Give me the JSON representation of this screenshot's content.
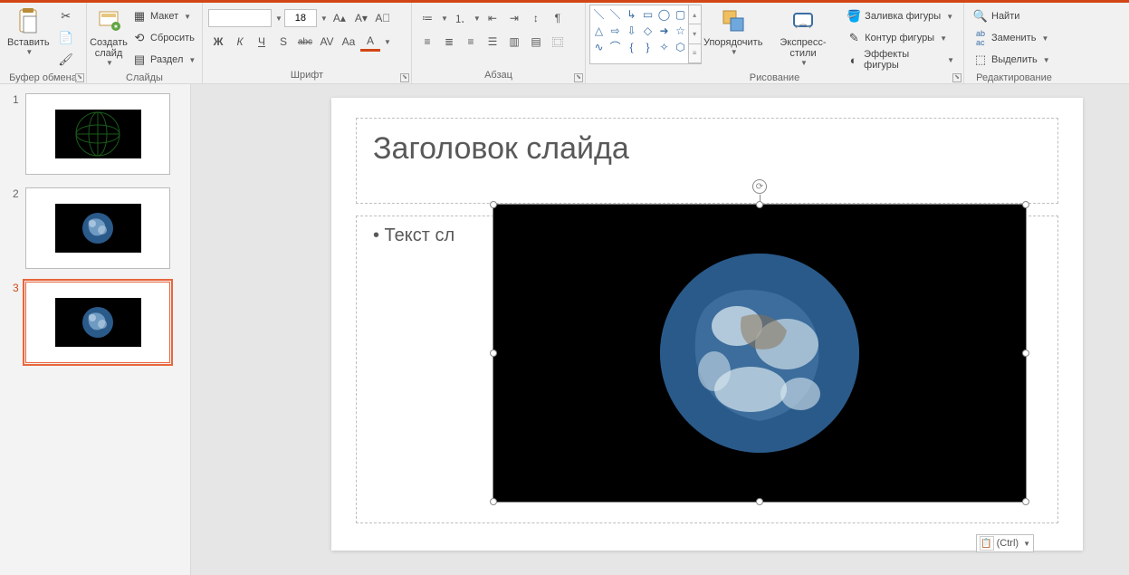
{
  "ribbon": {
    "clipboard": {
      "label": "Буфер обмена",
      "paste": "Вставить",
      "cut": "✂",
      "copy": "📄",
      "format_painter": "🖌"
    },
    "slides": {
      "label": "Слайды",
      "new_slide": "Создать слайд",
      "layout": "Макет",
      "reset": "Сбросить",
      "section": "Раздел"
    },
    "font": {
      "label": "Шрифт",
      "name": "",
      "size": "18",
      "bold": "Ж",
      "italic": "К",
      "underline": "Ч",
      "shadow": "S",
      "strike": "abc",
      "spacing": "AV",
      "case": "Aa",
      "color": "A",
      "grow": "A▴",
      "shrink": "A▾",
      "clear": "A⃠"
    },
    "paragraph": {
      "label": "Абзац"
    },
    "drawing": {
      "label": "Рисование",
      "arrange": "Упорядочить",
      "quick_styles": "Экспресс-стили",
      "fill": "Заливка фигуры",
      "outline": "Контур фигуры",
      "effects": "Эффекты фигуры"
    },
    "editing": {
      "label": "Редактирование",
      "find": "Найти",
      "replace": "Заменить",
      "select": "Выделить"
    }
  },
  "thumbs": [
    {
      "num": "1"
    },
    {
      "num": "2"
    },
    {
      "num": "3"
    }
  ],
  "slide": {
    "title": "Заголовок слайда",
    "body": "• Текст сл"
  },
  "paste_options": {
    "label": "(Ctrl)"
  }
}
